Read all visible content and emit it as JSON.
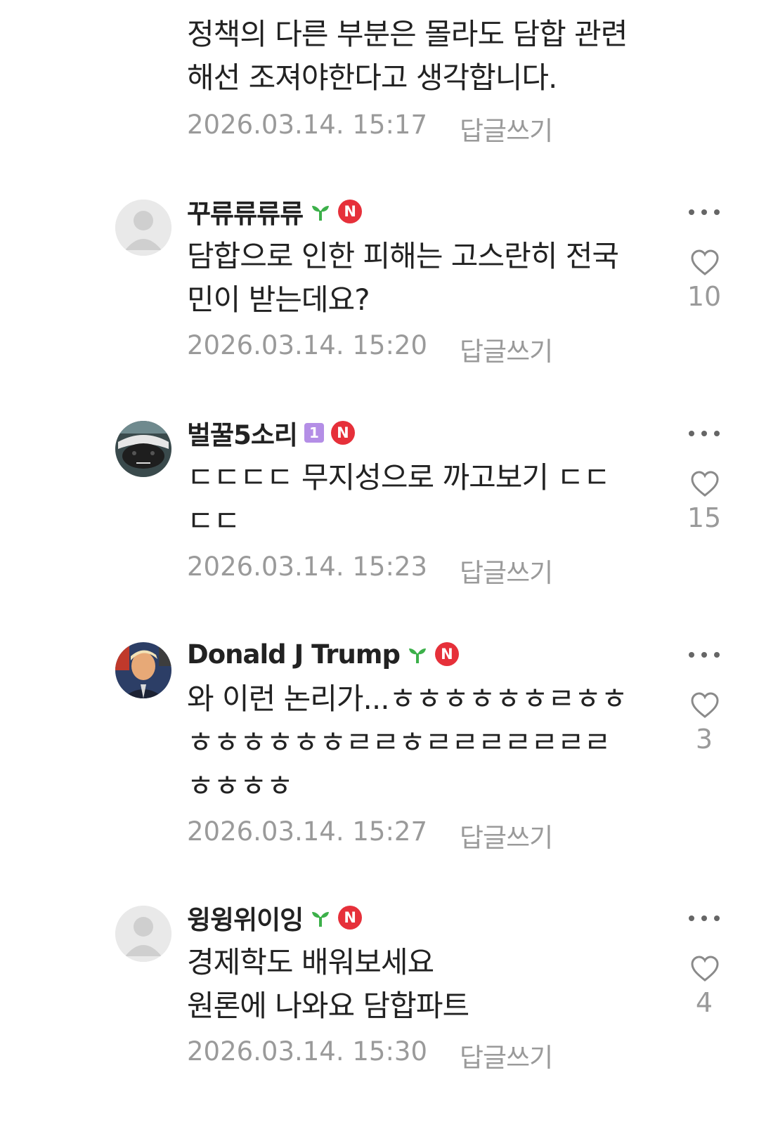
{
  "top_comment": {
    "text": "정책의 다른 부분은 몰라도 담합 관련\n해선 조져야한다고 생각합니다.",
    "timestamp": "2026.03.14. 15:17",
    "reply_label": "답글쓰기"
  },
  "comments": [
    {
      "name": "꾸류류류류",
      "text": "담합으로 인한 피해는 고스란히 전국\n민이 받는데요?",
      "timestamp": "2026.03.14. 15:20",
      "likes": "10",
      "reply_label": "답글쓰기",
      "badge": "N",
      "avatar": "default-avatar"
    },
    {
      "name": "벌꿀5소리",
      "level": "1",
      "text": "ㄷㄷㄷㄷ 무지성으로 까고보기 ㄷㄷ\nㄷㄷ",
      "timestamp": "2026.03.14. 15:23",
      "likes": "15",
      "reply_label": "답글쓰기",
      "badge": "N",
      "avatar": "honey-badger-avatar"
    },
    {
      "name": "Donald J Trump",
      "text": "와 이런 논리가...ㅎㅎㅎㅎㅎㅎㄹㅎㅎ\nㅎㅎㅎㅎㅎㅎㄹㄹㅎㄹㄹㄹㄹㄹㄹㄹ\nㅎㅎㅎㅎ",
      "timestamp": "2026.03.14. 15:27",
      "likes": "3",
      "reply_label": "답글쓰기",
      "badge": "N",
      "avatar": "portrait-avatar"
    },
    {
      "name": "윙윙위이잉",
      "text": "경제학도 배워보세요\n원론에 나와요 담합파트",
      "timestamp": "2026.03.14. 15:30",
      "likes": "4",
      "reply_label": "답글쓰기",
      "badge": "N",
      "avatar": "default-avatar"
    }
  ],
  "colors": {
    "badge_red": "#e6303a",
    "sprout_green": "#3cb04a",
    "level_purple": "#b48ee6",
    "meta_gray": "#9a9a9a"
  }
}
